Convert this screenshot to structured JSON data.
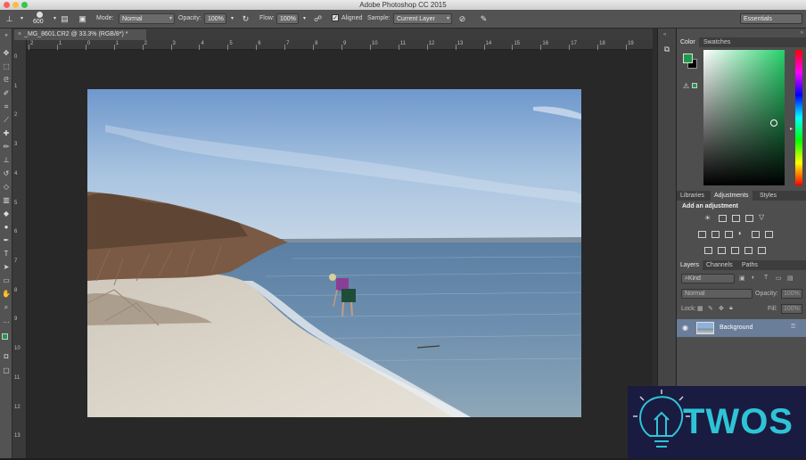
{
  "window": {
    "title": "Adobe Photoshop CC 2015"
  },
  "options_bar": {
    "brush_size": "600",
    "mode_label": "Mode:",
    "mode_value": "Normal",
    "opacity_label": "Opacity:",
    "opacity_value": "100%",
    "flow_label": "Flow:",
    "flow_value": "100%",
    "aligned_label": "Aligned",
    "aligned_checked": true,
    "sample_label": "Sample:",
    "sample_value": "Current Layer",
    "workspace": "Essentials"
  },
  "document": {
    "tab_title": "_MG_8601.CR2 @ 33.3% (RGB/8*) *",
    "ruler_h_ticks": [
      "2",
      "1",
      "0",
      "1",
      "2",
      "3",
      "4",
      "5",
      "6",
      "7",
      "8",
      "9",
      "10",
      "11",
      "12",
      "13",
      "14",
      "15",
      "16",
      "17",
      "18",
      "19"
    ],
    "ruler_v_ticks": [
      "0",
      "1",
      "2",
      "3",
      "4",
      "5",
      "6",
      "7",
      "8",
      "9",
      "10",
      "11",
      "12",
      "13"
    ]
  },
  "color_panel": {
    "tabs": [
      "Color",
      "Swatches"
    ],
    "active_tab": "Color",
    "foreground": "#1f9a4a",
    "background": "#000000",
    "hue_color": "#27d16b"
  },
  "adjustments_panel": {
    "tabs": [
      "Libraries",
      "Adjustments",
      "Styles"
    ],
    "active_tab": "Adjustments",
    "heading": "Add an adjustment"
  },
  "layers_panel": {
    "tabs": [
      "Layers",
      "Channels",
      "Paths"
    ],
    "active_tab": "Layers",
    "filter_kind": "Kind",
    "blend_mode": "Normal",
    "opacity_label": "Opacity:",
    "opacity_value": "100%",
    "lock_label": "Lock:",
    "fill_label": "Fill:",
    "fill_value": "100%",
    "layers": [
      {
        "name": "Background",
        "visible": true,
        "locked": true
      }
    ]
  },
  "watermark": {
    "text": "TWOS",
    "color": "#2ec4d6"
  },
  "colors": {
    "accent": "#2ec4d6",
    "options_bar": "#535353",
    "panel": "#4e4e4e",
    "canvas": "#282828"
  }
}
